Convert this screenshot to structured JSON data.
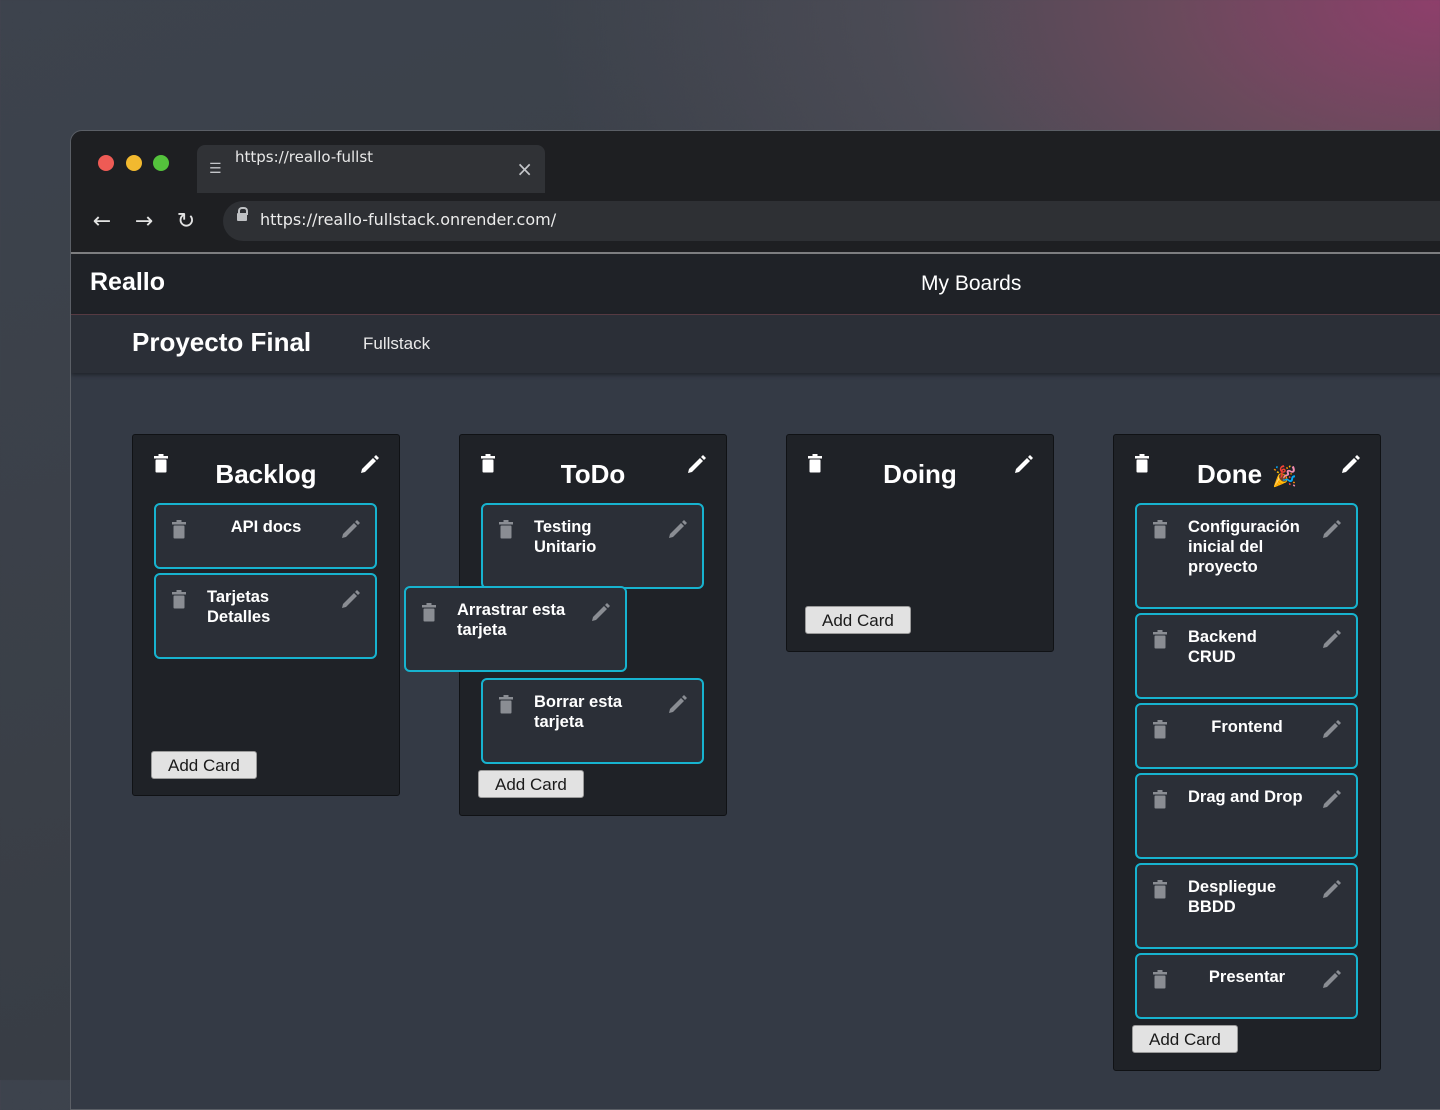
{
  "browser": {
    "tab_title": "https://reallo-fullstack.onrender.com/",
    "url": "https://reallo-fullstack.onrender.com/",
    "close_glyph": "×",
    "back_glyph": "←",
    "forward_glyph": "→",
    "reload_glyph": "↻"
  },
  "app": {
    "brand": "Reallo",
    "nav_my_boards": "My Boards",
    "board_title": "Proyecto Final",
    "board_tag": "Fullstack"
  },
  "colors": {
    "card_border": "#17b3cf",
    "column_bg": "#1f2227",
    "board_bg": "#343a45"
  },
  "columns": [
    {
      "title": "Backlog",
      "add_label": "Add Card",
      "cards": [
        "API docs",
        "Tarjetas Detalles"
      ]
    },
    {
      "title": "ToDo",
      "add_label": "Add Card",
      "cards": [
        "Testing Unitario",
        "Borrar esta tarjeta"
      ]
    },
    {
      "title": "Doing",
      "add_label": "Add Card",
      "cards": []
    },
    {
      "title": "Done",
      "emoji": "🎉",
      "add_label": "Add Card",
      "cards": [
        "Configuración inicial del proyecto",
        "Backend CRUD",
        "Frontend",
        "Drag and Drop",
        "Despliegue BBDD",
        "Presentar"
      ]
    }
  ],
  "dragging_card": "Arrastrar esta tarjeta",
  "icons": {
    "delete": "trash-icon",
    "edit": "pencil-icon"
  }
}
